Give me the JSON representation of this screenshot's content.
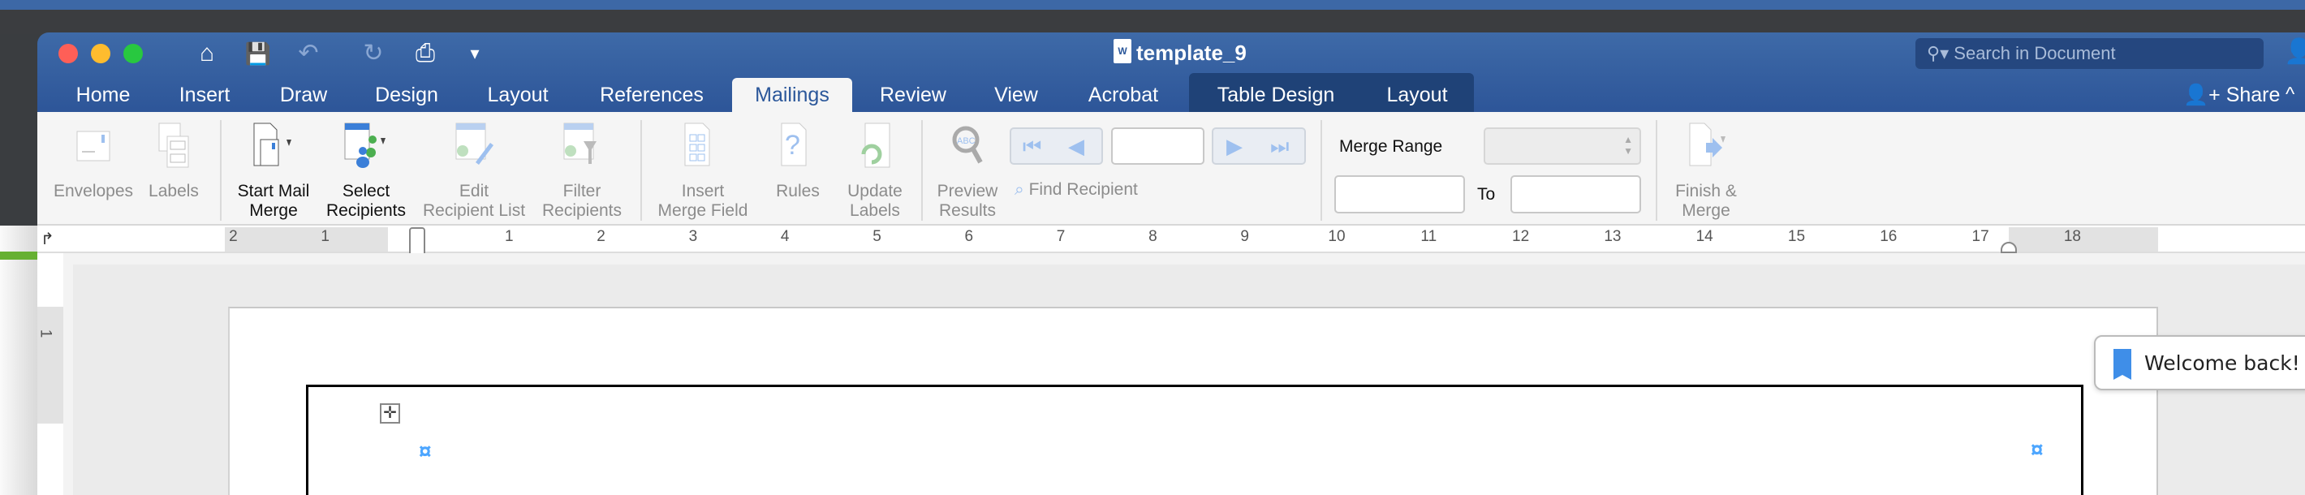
{
  "window": {
    "title": "template_9",
    "doc_icon": "W"
  },
  "colors": {
    "accent": "#2b579a",
    "titlebar": "#3e6aa8",
    "context_tab": "#1f4277",
    "anchor": "#4da6ff",
    "bookmark": "#3f8ee8"
  },
  "quick_access": [
    {
      "icon": "home-icon",
      "glyph": "⌂"
    },
    {
      "icon": "save-icon",
      "glyph": "💾"
    },
    {
      "icon": "undo-icon",
      "glyph": "↶"
    },
    {
      "icon": "redo-icon",
      "glyph": "↻"
    },
    {
      "icon": "print-icon",
      "glyph": "⎙"
    },
    {
      "icon": "customize-icon",
      "glyph": "▾"
    }
  ],
  "search": {
    "placeholder": "Search in Document"
  },
  "tabs": [
    "Home",
    "Insert",
    "Draw",
    "Design",
    "Layout",
    "References",
    "Mailings",
    "Review",
    "View",
    "Acrobat"
  ],
  "active_tab": "Mailings",
  "context_tabs": [
    "Table Design",
    "Layout"
  ],
  "share": "Share",
  "ribbon": {
    "envelopes": "Envelopes",
    "labels": "Labels",
    "start_mail_merge": [
      "Start Mail",
      "Merge"
    ],
    "select_recipients": [
      "Select",
      "Recipients"
    ],
    "edit_recipient_list": [
      "Edit",
      "Recipient List"
    ],
    "filter_recipients": [
      "Filter",
      "Recipients"
    ],
    "insert_merge_field": [
      "Insert",
      "Merge Field"
    ],
    "rules": "Rules",
    "update_labels": [
      "Update",
      "Labels"
    ],
    "preview_results": [
      "Preview",
      "Results"
    ],
    "find_recipient": "Find Recipient",
    "record_value": "",
    "merge_range": "Merge Range",
    "from_value": "",
    "to_label": "To",
    "to_value": "",
    "finish_merge": [
      "Finish &",
      "Merge"
    ]
  },
  "ruler": {
    "labels": [
      "2",
      "1",
      "1",
      "2",
      "3",
      "4",
      "5",
      "6",
      "7",
      "8",
      "9",
      "10",
      "11",
      "12",
      "13",
      "14",
      "15",
      "16",
      "17",
      "18"
    ],
    "vertical_labels": [
      "1"
    ]
  },
  "toast": {
    "text": "Welcome back!",
    "icon": "bookmark-icon"
  }
}
